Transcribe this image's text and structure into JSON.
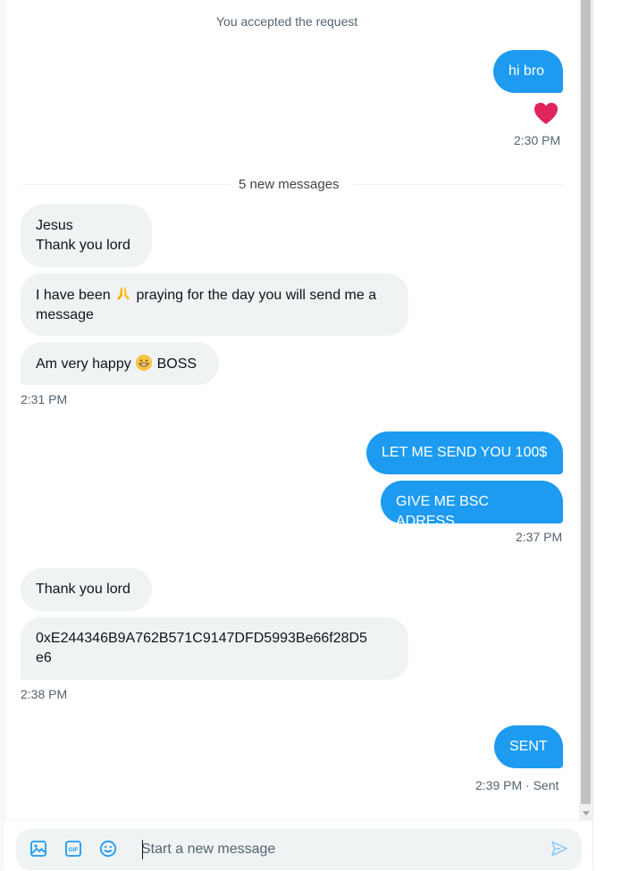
{
  "conversation": {
    "accepted_notice": "You accepted the request",
    "new_messages_divider": "5 new messages",
    "messages": [
      {
        "id": "m1",
        "dir": "out",
        "text": "hi bro"
      },
      {
        "id": "m2",
        "dir": "in",
        "text": "Jesus\nThank you lord"
      },
      {
        "id": "m3a",
        "dir": "in",
        "text": "I have been"
      },
      {
        "id": "m3b",
        "dir": "in",
        "text": "praying for the day you will send me a\nmessage"
      },
      {
        "id": "m4a",
        "dir": "in",
        "text": "Am very happy"
      },
      {
        "id": "m4b",
        "dir": "in",
        "text": "BOSS"
      },
      {
        "id": "m5",
        "dir": "out",
        "text": "LET ME SEND YOU 100$"
      },
      {
        "id": "m6",
        "dir": "out",
        "text": "GIVE ME BSC ADRESS"
      },
      {
        "id": "m7",
        "dir": "in",
        "text": "Thank you lord"
      },
      {
        "id": "m8",
        "dir": "in",
        "text": "0xE244346B9A762B571C9147DFD5993Be66f28D5\ne6"
      },
      {
        "id": "m9",
        "dir": "out",
        "text": "SENT"
      }
    ],
    "timestamps": {
      "t1": "2:30 PM",
      "t2": "2:31 PM",
      "t3": "2:37 PM",
      "t4": "2:38 PM",
      "t5": "2:39 PM · Sent"
    },
    "reaction_icon": "heart-icon",
    "emojis": {
      "pray": "🙏",
      "grin": "😁"
    }
  },
  "composer": {
    "placeholder": "Start a new message",
    "icons": [
      "image-icon",
      "gif-icon",
      "emoji-icon",
      "send-icon"
    ]
  },
  "colors": {
    "outgoing_bubble": "#1d9bf0",
    "incoming_bubble": "#eff3f4",
    "meta_text": "#536471",
    "heart": "#f91880"
  }
}
